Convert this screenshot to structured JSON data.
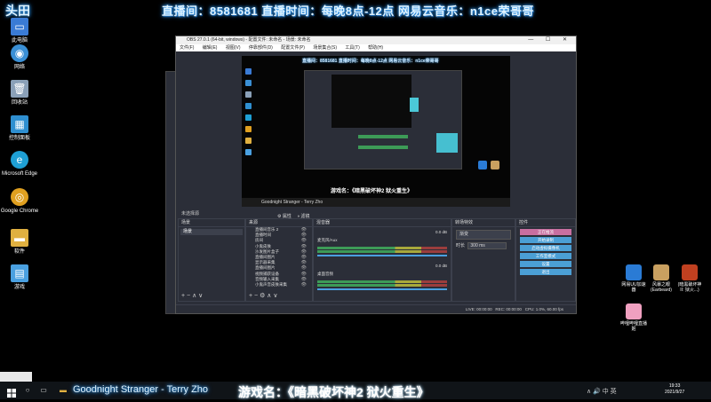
{
  "top_banner": "直播间：8581681 直播时间：每晚8点-12点 网易云音乐：n1ce荣哥哥",
  "corner_logo": "头田",
  "desktop_icons": [
    {
      "label": "此电脑",
      "icon": "computer-icon",
      "color": "#3a7bd5"
    },
    {
      "label": "网络",
      "icon": "network-icon",
      "color": "#3a8fd5"
    },
    {
      "label": "回收站",
      "icon": "recycle-bin-icon",
      "color": "#8aa0b8"
    },
    {
      "label": "控制面板",
      "icon": "control-panel-icon",
      "color": "#2f8fd0"
    },
    {
      "label": "Microsoft Edge",
      "icon": "edge-icon",
      "color": "#1e9fd4"
    },
    {
      "label": "Google Chrome",
      "icon": "chrome-icon",
      "color": "#e0a020"
    },
    {
      "label": "软件",
      "icon": "folder-icon",
      "color": "#e0b040"
    },
    {
      "label": "游戏",
      "icon": "file-icon",
      "color": "#4aa0e0"
    }
  ],
  "obs": {
    "title": "OBS 27.0.1 (64-bit, windows) - 配置文件: 未命名 - 场景: 未命名",
    "menu": [
      "文件(F)",
      "编辑(E)",
      "视图(V)",
      "停靠部件(D)",
      "配置文件(P)",
      "场景集合(S)",
      "工具(T)",
      "帮助(H)"
    ],
    "preview_banner": "直播间：8581681 直播时间：每晚8点-12点 网易云音乐：n1ce荣哥哥",
    "preview_game": "游戏名：《暗黑破坏神2 狱火重生》",
    "preview_song": "Goodnight Stranger - Terry Zho",
    "source_toolbar": [
      "属性",
      "滤镜"
    ],
    "no_source_label": "未选择源",
    "scenes_header": "场景",
    "scene_selected": "场景",
    "sources_header": "来源",
    "sources": [
      "直播间音乐 2",
      "直播时间",
      "房间",
      "小鬼皮肤",
      "沙发图片盒子",
      "直播间图片",
      "显示器采集",
      "直播间图片",
      "视频捕获设备",
      "音频输入采集",
      "小鬼声音皮肤采集",
      "游戏捕获"
    ],
    "mixer_header": "混音器",
    "mixer": [
      {
        "name": "麦克风/Aux",
        "db": "0.0 dB"
      },
      {
        "name": "桌面音频",
        "db": "0.0 dB"
      }
    ],
    "transitions_header": "转场特效",
    "transition_type": "渐变",
    "duration_label": "时长",
    "duration_value": "300 ms",
    "controls_header": "控件",
    "controls": [
      "正在推流",
      "开始录制",
      "启动虚拟摄像机",
      "工作室模式",
      "设置",
      "退出"
    ],
    "status": {
      "live": "LIVE: 00:00:00",
      "rec": "REC: 00:00:00",
      "cpu": "CPU: 1.0%, 60.00 fps"
    }
  },
  "right_icons": [
    {
      "label": "网易UU加速器",
      "icon": "uu-icon",
      "color": "#2a7bd5"
    },
    {
      "label": "风暴之眼(Earbeard)",
      "icon": "game-icon",
      "color": "#c9a060"
    },
    {
      "label": "(暗黑破坏神 II: 狱火...)",
      "icon": "diablo-icon",
      "color": "#c04020"
    },
    {
      "label": "哔哩哔哩直播姬",
      "icon": "bilibili-icon",
      "color": "#f0a0c0"
    }
  ],
  "taskbar": {
    "song": "Goodnight Stranger - Terry Zho",
    "game": "游戏名：《暗黑破坏神2 狱火重生》",
    "time": "19:33",
    "date": "2021/9/27",
    "tray": "∧ 🔊 中 英"
  }
}
